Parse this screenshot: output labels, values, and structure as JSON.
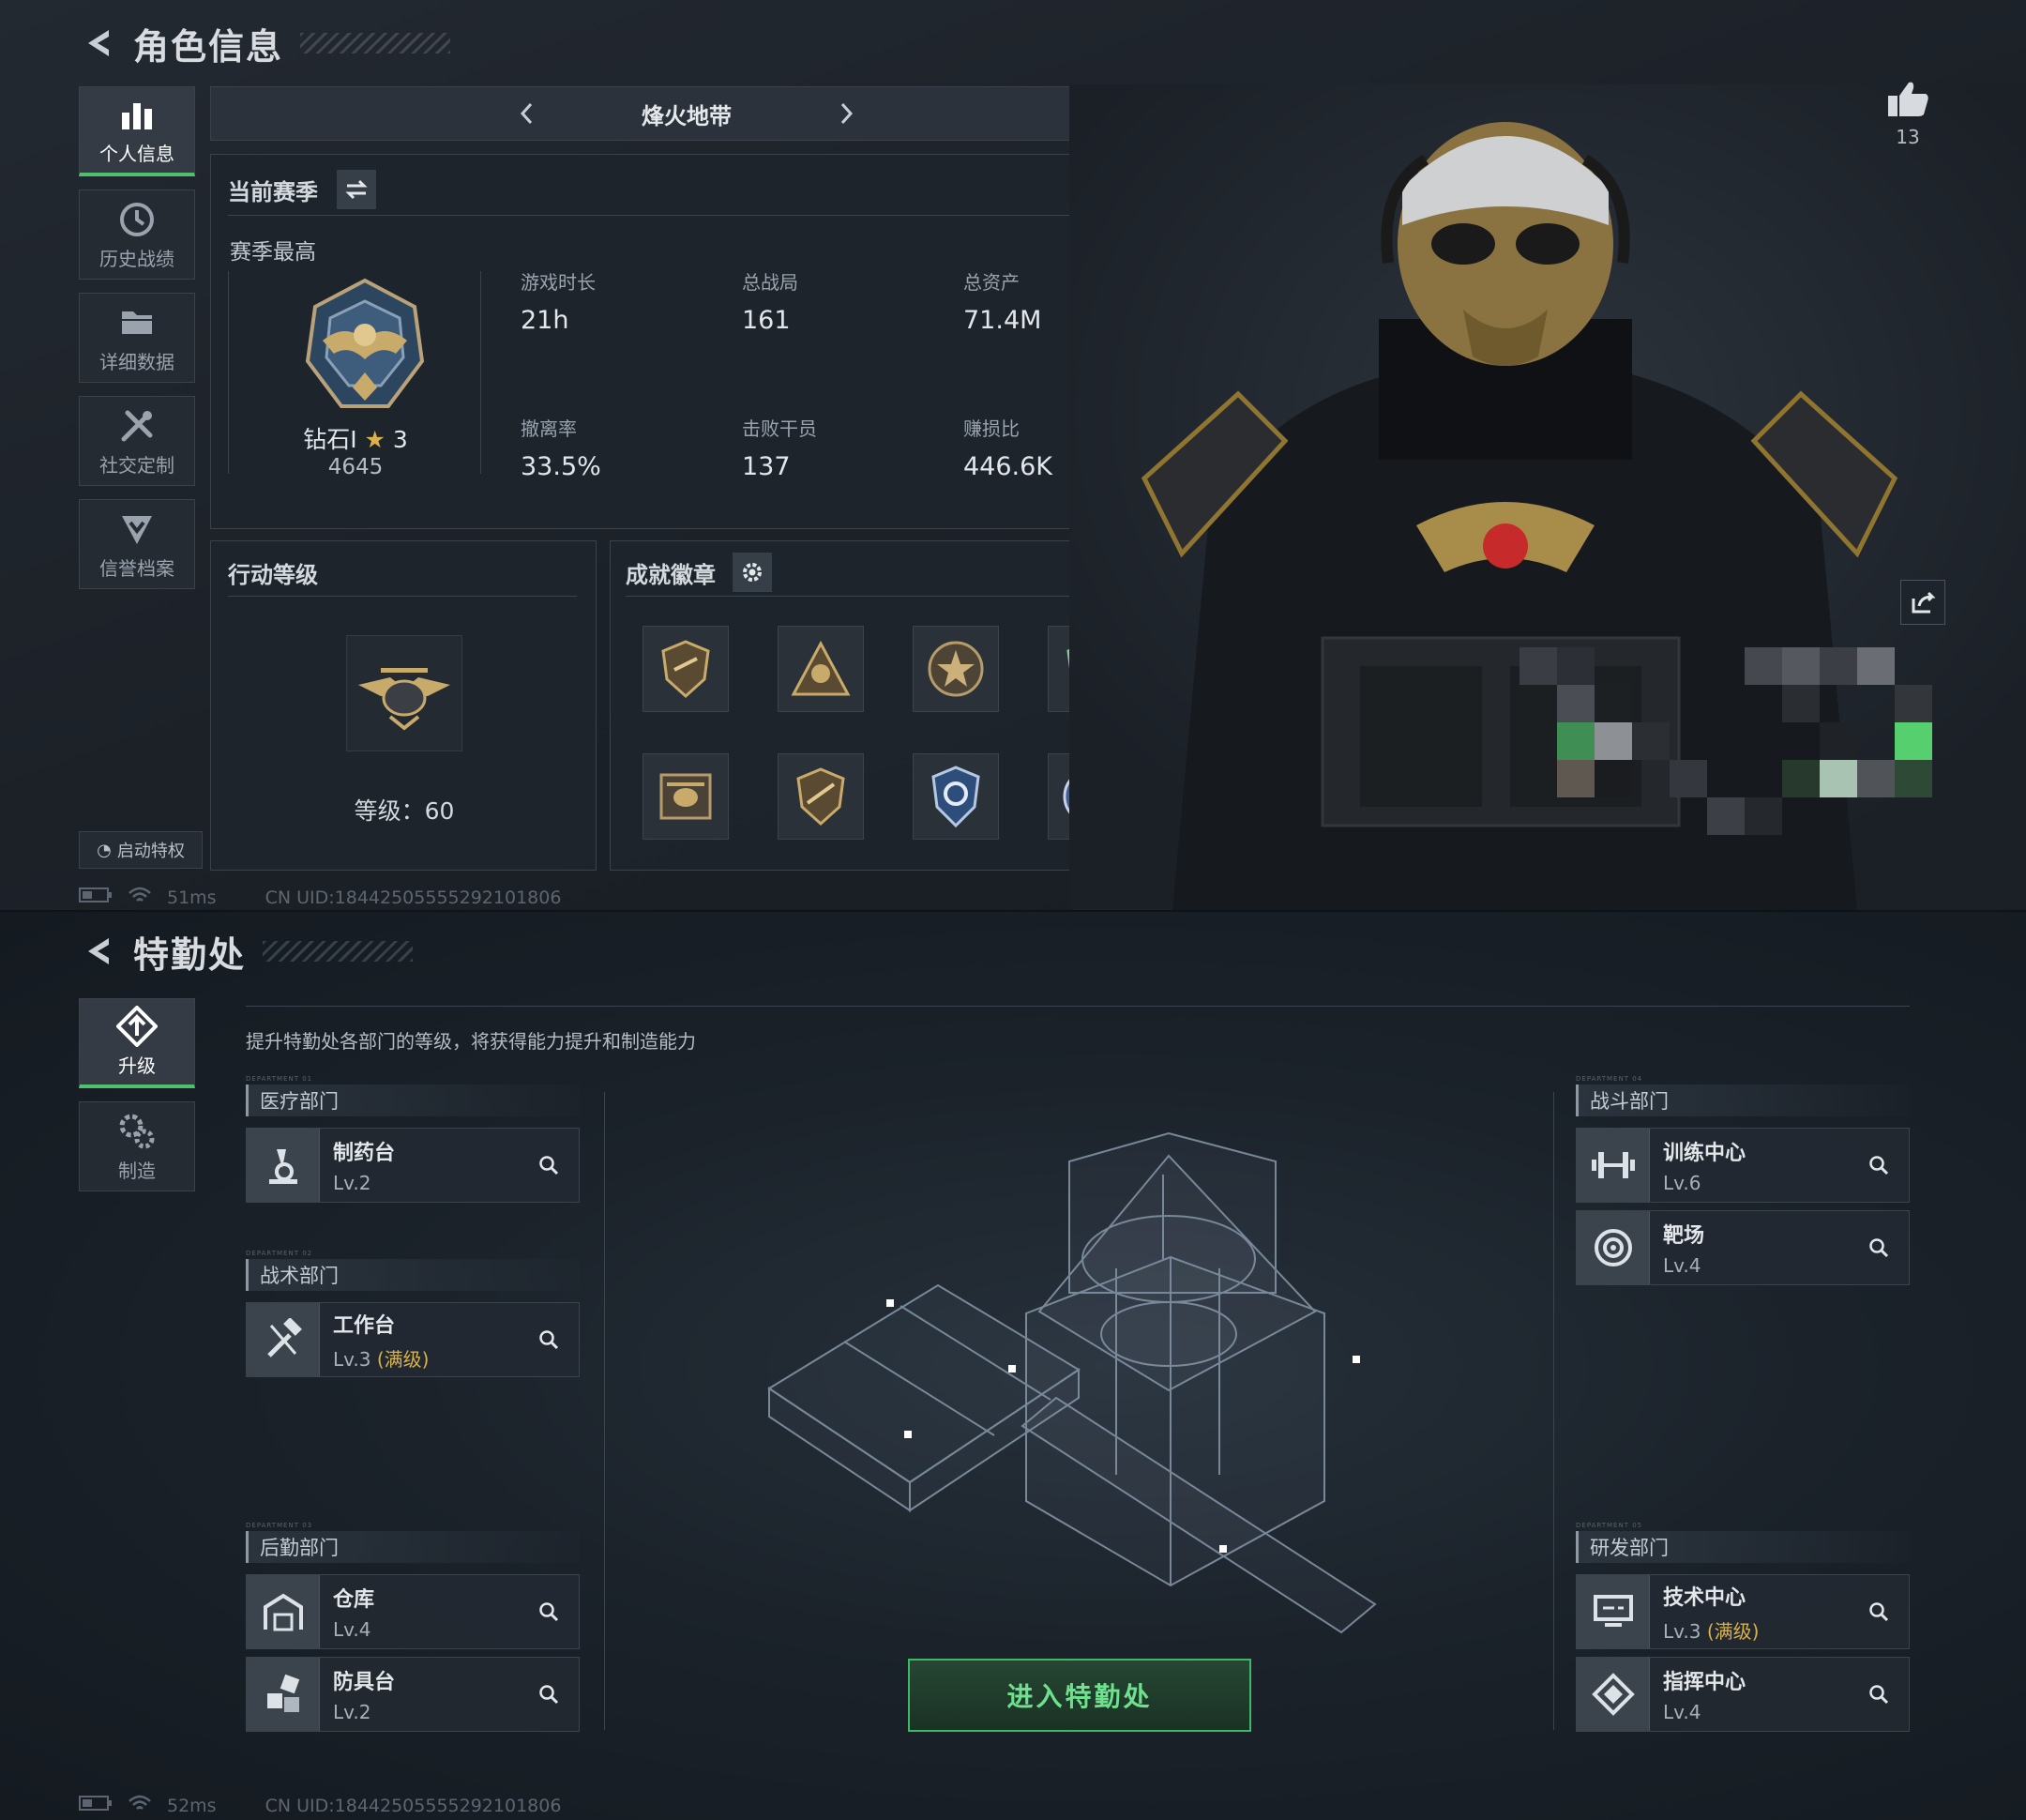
{
  "screen1": {
    "title": "角色信息",
    "nav": [
      {
        "label": "个人信息",
        "icon": "bar-chart-icon",
        "active": true
      },
      {
        "label": "历史战绩",
        "icon": "clock-icon"
      },
      {
        "label": "详细数据",
        "icon": "folder-icon"
      },
      {
        "label": "社交定制",
        "icon": "wrench-icon"
      },
      {
        "label": "信誉档案",
        "icon": "shield-check-icon"
      }
    ],
    "perk_button": "启动特权",
    "mode": "烽火地带",
    "season_header": "当前赛季",
    "season_best": "赛季最高",
    "rank": {
      "name": "钻石I",
      "stars": "3",
      "score": "4645"
    },
    "stats": [
      {
        "label": "游戏时长",
        "value": "21h"
      },
      {
        "label": "总战局",
        "value": "161"
      },
      {
        "label": "总资产",
        "value": "71.4M"
      },
      {
        "label": "撤离率",
        "value": "33.5%"
      },
      {
        "label": "击败干员",
        "value": "137"
      },
      {
        "label": "赚损比",
        "value": "446.6K"
      }
    ],
    "action_level": {
      "title": "行动等级",
      "level_text": "等级：60"
    },
    "achievements_title": "成就徽章",
    "likes": "13",
    "status": {
      "ping": "51ms",
      "uid": "CN UID:18442505555292101806"
    }
  },
  "screen2": {
    "title": "特勤处",
    "nav": [
      {
        "label": "升级",
        "icon": "upgrade-icon",
        "active": true
      },
      {
        "label": "制造",
        "icon": "gears-icon"
      }
    ],
    "description": "提升特勤处各部门的等级，将获得能力提升和制造能力",
    "departments": {
      "medical": {
        "tag": "DEPARTMENT 01",
        "name": "医疗部门",
        "facilities": [
          {
            "name": "制药台",
            "level": "Lv.2",
            "icon": "microscope-icon"
          }
        ]
      },
      "tactical": {
        "tag": "DEPARTMENT 02",
        "name": "战术部门",
        "facilities": [
          {
            "name": "工作台",
            "level": "Lv.3",
            "max": "(满级)",
            "icon": "hammer-icon"
          }
        ]
      },
      "logistics": {
        "tag": "DEPARTMENT 03",
        "name": "后勤部门",
        "facilities": [
          {
            "name": "仓库",
            "level": "Lv.4",
            "icon": "warehouse-icon"
          },
          {
            "name": "防具台",
            "level": "Lv.2",
            "icon": "armor-icon"
          }
        ]
      },
      "combat": {
        "tag": "DEPARTMENT 04",
        "name": "战斗部门",
        "facilities": [
          {
            "name": "训练中心",
            "level": "Lv.6",
            "icon": "dumbbell-icon"
          },
          {
            "name": "靶场",
            "level": "Lv.4",
            "icon": "target-icon"
          }
        ]
      },
      "research": {
        "tag": "DEPARTMENT 05",
        "name": "研发部门",
        "facilities": [
          {
            "name": "技术中心",
            "level": "Lv.3",
            "max": "(满级)",
            "icon": "monitor-icon"
          },
          {
            "name": "指挥中心",
            "level": "Lv.4",
            "icon": "command-icon"
          }
        ]
      }
    },
    "enter_button": "进入特勤处",
    "status": {
      "ping": "52ms",
      "uid": "CN UID:18442505555292101806"
    }
  },
  "colors": {
    "accent_green": "#4fc06c",
    "max_gold": "#d9b24a",
    "panel": "#1e242c"
  }
}
